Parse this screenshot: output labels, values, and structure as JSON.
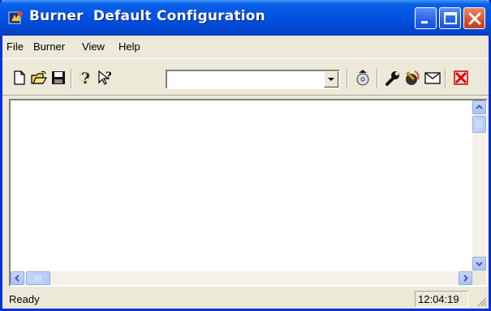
{
  "window": {
    "title": "Burner  Default Configuration",
    "title_color": "#ffffff",
    "titlebar_color": "#0054e3"
  },
  "menu": {
    "items": [
      {
        "label": "File"
      },
      {
        "label": "Burner"
      },
      {
        "label": "View"
      },
      {
        "label": "Help"
      }
    ]
  },
  "toolbar": {
    "buttons": [
      {
        "icon": "new-document-icon"
      },
      {
        "icon": "open-folder-icon"
      },
      {
        "icon": "save-disk-icon"
      },
      {
        "icon": "help-question-icon"
      },
      {
        "icon": "context-help-icon"
      },
      {
        "icon": "burn-disc-icon"
      },
      {
        "icon": "settings-wrench-icon"
      },
      {
        "icon": "burner-tool-icon"
      },
      {
        "icon": "mail-envelope-icon"
      },
      {
        "icon": "exit-stop-icon"
      }
    ],
    "combo": {
      "value": ""
    }
  },
  "status": {
    "text": "Ready",
    "time": "12:04:19"
  }
}
